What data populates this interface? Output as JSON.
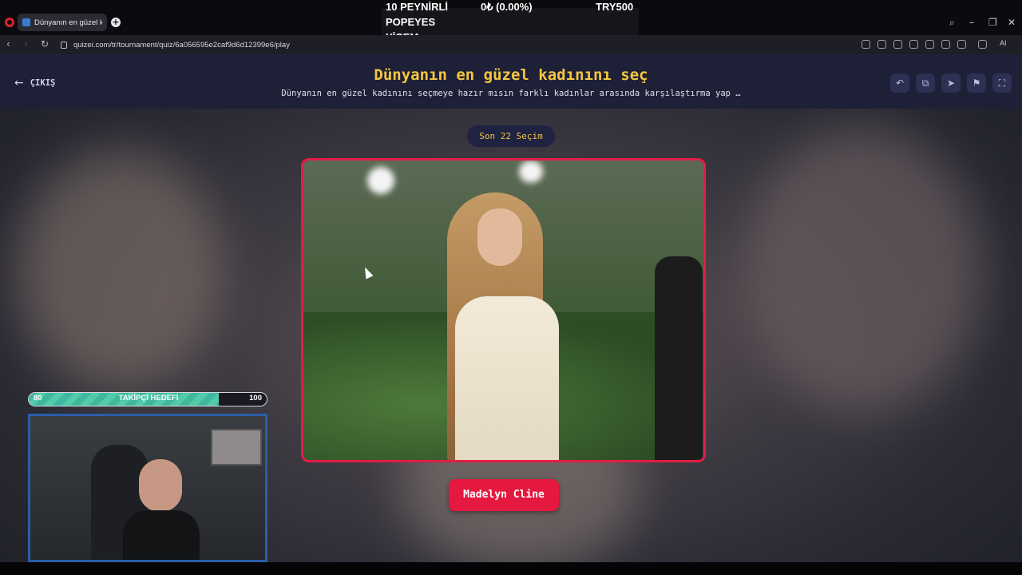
{
  "browser": {
    "tab_title": "Dünyanın en güzel kadınını",
    "url": "quizei.com/tr/tournament/quiz/6a056595e2caf9d6d12399e6/play",
    "ai_label": "AI"
  },
  "ticker": {
    "line1": "10 PEYNİRLİ",
    "line2": "POPEYES",
    "line3": "YİCEM",
    "balance": "0₺ (0.00%)",
    "goal_amount": "TRY500"
  },
  "header": {
    "back_label": "ÇIKIŞ",
    "title": "Dünyanın en güzel kadınını seç",
    "subtitle": "Dünyanın en güzel kadınını seçmeye hazır mısın farklı kadınlar arasında karşılaştırma yap …",
    "buttons": [
      "undo-icon",
      "share-icon",
      "send-icon",
      "flag-icon",
      "fullscreen-icon"
    ]
  },
  "quiz": {
    "round_label": "Son 22 Seçim",
    "choice_label": "Madelyn Cline"
  },
  "overlay": {
    "goal_label": "TAKİPÇİ HEDEFİ",
    "goal_current": "80",
    "goal_target": "100",
    "goal_progress": 0.8
  },
  "colors": {
    "accent": "#f3c63f",
    "button": "#e5193f",
    "card_border": "#e21d44",
    "header_bg": "#1e2038"
  }
}
